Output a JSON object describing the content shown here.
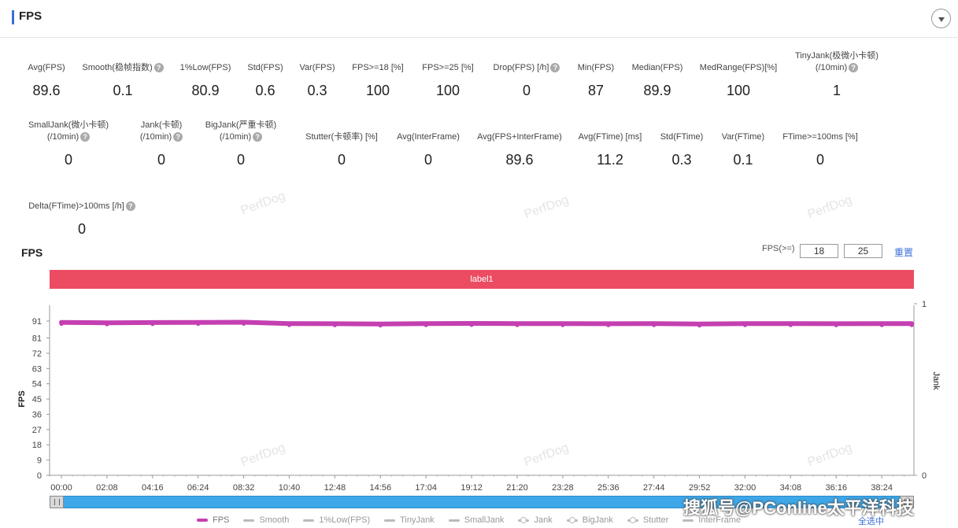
{
  "header": {
    "title": "FPS"
  },
  "metrics_row1": [
    {
      "label": "Avg(FPS)",
      "value": "89.6",
      "help": false
    },
    {
      "label": "Smooth(稳帧指数)",
      "value": "0.1",
      "help": true
    },
    {
      "label": "1%Low(FPS)",
      "value": "80.9",
      "help": false
    },
    {
      "label": "Std(FPS)",
      "value": "0.6",
      "help": false
    },
    {
      "label": "Var(FPS)",
      "value": "0.3",
      "help": false
    },
    {
      "label": "FPS>=18 [%]",
      "value": "100",
      "help": false
    },
    {
      "label": "FPS>=25 [%]",
      "value": "100",
      "help": false
    },
    {
      "label": "Drop(FPS) [/h]",
      "value": "0",
      "help": true
    },
    {
      "label": "Min(FPS)",
      "value": "87",
      "help": false
    },
    {
      "label": "Median(FPS)",
      "value": "89.9",
      "help": false
    },
    {
      "label": "MedRange(FPS)[%]",
      "value": "100",
      "help": false
    },
    {
      "label": "TinyJank(极微小卡顿)",
      "label2": "(/10min)",
      "value": "1",
      "help": true
    }
  ],
  "metrics_row2": [
    {
      "label": "SmallJank(微小卡顿)",
      "label2": "(/10min)",
      "value": "0",
      "help": true
    },
    {
      "label": "Jank(卡顿)",
      "label2": "(/10min)",
      "value": "0",
      "help": true
    },
    {
      "label": "BigJank(严重卡顿)",
      "label2": "(/10min)",
      "value": "0",
      "help": true
    },
    {
      "label": "Stutter(卡顿率) [%]",
      "value": "0",
      "help": false
    },
    {
      "label": "Avg(InterFrame)",
      "value": "0",
      "help": false
    },
    {
      "label": "Avg(FPS+InterFrame)",
      "value": "89.6",
      "help": false
    },
    {
      "label": "Avg(FTime) [ms]",
      "value": "11.2",
      "help": false
    },
    {
      "label": "Std(FTime)",
      "value": "0.3",
      "help": false
    },
    {
      "label": "Var(FTime)",
      "value": "0.1",
      "help": false
    },
    {
      "label": "FTime>=100ms [%]",
      "value": "0",
      "help": false
    }
  ],
  "metrics_row3": [
    {
      "label": "Delta(FTime)>100ms [/h]",
      "value": "0",
      "help": true
    }
  ],
  "watermark": "PerfDog",
  "chart_header": {
    "title": "FPS",
    "filter_label": "FPS(>=)",
    "threshold_1": "18",
    "threshold_2": "25",
    "reset_label": "重置"
  },
  "label_bar": "label1",
  "legend": {
    "items": [
      "FPS",
      "Smooth",
      "1%Low(FPS)",
      "TinyJank",
      "SmallJank",
      "Jank",
      "BigJank",
      "Stutter",
      "InterFrame"
    ],
    "select_all": "全选中"
  },
  "corner_watermark": "搜狐号@PConline太平洋科技",
  "colors": {
    "fps_series": "#c43fb1",
    "label_bar": "#ec4c62",
    "slider": "#3ea7e8",
    "accent": "#3a6fd6"
  },
  "chart_data": {
    "type": "line",
    "ylabel": "FPS",
    "y2label": "Jank",
    "y_ticks": [
      0,
      9,
      18,
      27,
      36,
      45,
      54,
      63,
      72,
      81,
      91
    ],
    "ylim": [
      0,
      91
    ],
    "y2_ticks": [
      0,
      1
    ],
    "x_ticks": [
      "00:00",
      "02:08",
      "04:16",
      "06:24",
      "08:32",
      "10:40",
      "12:48",
      "14:56",
      "17:04",
      "19:12",
      "21:20",
      "23:28",
      "25:36",
      "27:44",
      "29:52",
      "32:00",
      "34:08",
      "36:16",
      "38:24"
    ],
    "series": [
      {
        "name": "FPS",
        "x": [
          "00:00",
          "02:08",
          "04:16",
          "06:24",
          "08:32",
          "10:40",
          "12:48",
          "14:56",
          "17:04",
          "19:12",
          "21:20",
          "23:28",
          "25:36",
          "27:44",
          "29:52",
          "32:00",
          "34:08",
          "36:16",
          "38:24",
          "39:48"
        ],
        "values": [
          90.2,
          90.0,
          90.1,
          90.2,
          90.3,
          89.5,
          89.4,
          89.3,
          89.5,
          89.6,
          89.5,
          89.5,
          89.4,
          89.5,
          89.3,
          89.5,
          89.5,
          89.4,
          89.5,
          89.5
        ]
      }
    ]
  }
}
